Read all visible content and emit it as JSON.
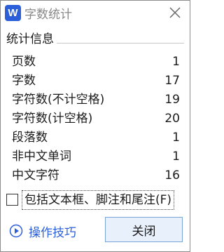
{
  "window": {
    "app_icon_letter": "W",
    "title": "字数统计"
  },
  "group": {
    "title": "统计信息",
    "rows": [
      {
        "label": "页数",
        "value": "1"
      },
      {
        "label": "字数",
        "value": "17"
      },
      {
        "label": "字符数(不计空格)",
        "value": "19"
      },
      {
        "label": "字符数(计空格)",
        "value": "20"
      },
      {
        "label": "段落数",
        "value": "1"
      },
      {
        "label": "非中文单词",
        "value": "1"
      },
      {
        "label": "中文字符",
        "value": "16"
      }
    ]
  },
  "checkbox": {
    "label": "包括文本框、脚注和尾注(F)",
    "checked": false
  },
  "footer": {
    "tips_label": "操作技巧",
    "close_label": "关闭"
  },
  "icons": {
    "app": "wps-writer-icon",
    "close": "close-icon",
    "tips": "play-circle-icon"
  },
  "colors": {
    "accent": "#2b5fd9",
    "button_bg": "#e8f0fb",
    "button_border": "#7aa4d8"
  }
}
